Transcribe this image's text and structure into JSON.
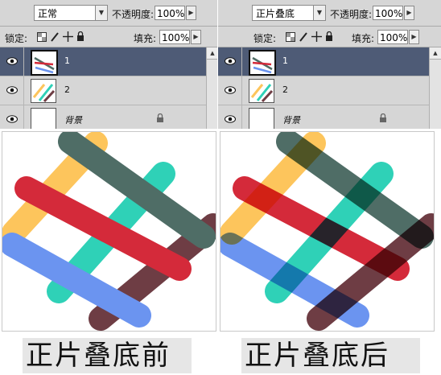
{
  "panels": [
    {
      "blend_mode": "正常",
      "opacity_label": "不透明度:",
      "opacity_value": "100%",
      "lock_label": "锁定:",
      "fill_label": "填充:",
      "fill_value": "100%",
      "layers": [
        {
          "name": "1",
          "selected": true
        },
        {
          "name": "2",
          "selected": false
        },
        {
          "name": "背景",
          "selected": false
        }
      ]
    },
    {
      "blend_mode": "正片叠底",
      "opacity_label": "不透明度:",
      "opacity_value": "100%",
      "lock_label": "锁定:",
      "fill_label": "填充:",
      "fill_value": "100%",
      "layers": [
        {
          "name": "1",
          "selected": true
        },
        {
          "name": "2",
          "selected": false
        },
        {
          "name": "背景",
          "selected": false
        }
      ]
    }
  ],
  "captions": {
    "before": "正片叠底前",
    "after": "正片叠底后"
  },
  "colors": {
    "yellow": "#fdc55c",
    "teal": "#2fd1b7",
    "red": "#d42a3a",
    "blue": "#6b94f0",
    "dark_green": "#4f6d66",
    "brown": "#6e3d44",
    "selected_layer": "#4e5b76",
    "panel_bg": "#d6d6d6"
  },
  "icons": {
    "eye": "eye-icon",
    "lock": "lock-icon",
    "dropdown": "chevron-down-icon",
    "arrow": "chevron-right-icon"
  }
}
